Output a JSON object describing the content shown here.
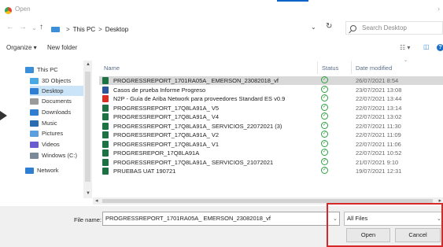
{
  "window": {
    "title": "Open"
  },
  "address": {
    "path": [
      "This PC",
      "Desktop"
    ],
    "separator": ">",
    "search_placeholder": "Search Desktop"
  },
  "toolbar": {
    "organize": "Organize ▾",
    "new_folder": "New folder"
  },
  "nav": {
    "items": [
      {
        "label": "This PC",
        "icon": "pc-icon",
        "color": "#3b8fd9"
      },
      {
        "label": "3D Objects",
        "icon": "3d-objects-icon",
        "color": "#49a8e6"
      },
      {
        "label": "Desktop",
        "icon": "desktop-icon",
        "color": "#2e7fd1",
        "selected": true
      },
      {
        "label": "Documents",
        "icon": "documents-icon",
        "color": "#9a9a9a"
      },
      {
        "label": "Downloads",
        "icon": "downloads-icon",
        "color": "#2e7fd1"
      },
      {
        "label": "Music",
        "icon": "music-icon",
        "color": "#2b6cb0"
      },
      {
        "label": "Pictures",
        "icon": "pictures-icon",
        "color": "#5aa0e0"
      },
      {
        "label": "Videos",
        "icon": "videos-icon",
        "color": "#6b5bd1"
      },
      {
        "label": "Windows (C:)",
        "icon": "drive-icon",
        "color": "#7a8a99"
      },
      {
        "label": "Network",
        "icon": "network-icon",
        "color": "#2e7fd1"
      }
    ]
  },
  "columns": {
    "name": "Name",
    "status": "Status",
    "date": "Date modified"
  },
  "files": [
    {
      "name": "PROGRESSREPORT_1701RA05A_ EMERSON_23082018_vf",
      "date": "26/07/2021 8:54",
      "type": "xls",
      "selected": true
    },
    {
      "name": "Casos de prueba Informe Progreso",
      "date": "23/07/2021 13:08",
      "type": "doc"
    },
    {
      "name": "N2P - Guía de Ariba Network para proveedores Standard ES v0.9",
      "date": "22/07/2021 13:44",
      "type": "pdf"
    },
    {
      "name": "PROGRESSREPORT_17Q8LA91A_ V5",
      "date": "22/07/2021 13:14",
      "type": "xls"
    },
    {
      "name": "PROGRESSREPORT_17Q8LA91A_ V4",
      "date": "22/07/2021 13:02",
      "type": "xls"
    },
    {
      "name": "PROGRESSREPORT_17Q8LA91A_ SERVICIOS_22072021 (3)",
      "date": "22/07/2021 11:30",
      "type": "xls"
    },
    {
      "name": "PROGRESSREPORT_17Q8LA91A_ V2",
      "date": "22/07/2021 11:09",
      "type": "xls"
    },
    {
      "name": "PROGRESSREPORT_17Q8LA91A_ V1",
      "date": "22/07/2021 11:06",
      "type": "xls"
    },
    {
      "name": "PROGRESREPOR_17Q8LA91A",
      "date": "22/07/2021 10:52",
      "type": "xls"
    },
    {
      "name": "PROGRESSREPORT_17Q8LA91A_ SERVICIOS_21072021",
      "date": "21/07/2021 9:10",
      "type": "xls"
    },
    {
      "name": "PRUEBAS UAT 190721",
      "date": "19/07/2021 12:31",
      "type": "xls"
    }
  ],
  "bottom": {
    "file_name_label": "File name:",
    "file_name_value": "PROGRESSREPORT_1701RA05A_ EMERSON_23082018_vf",
    "file_type": "All Files",
    "open_label": "Open",
    "cancel_label": "Cancel"
  },
  "colors": {
    "selection_nav": "#cce4f7",
    "selection_row": "#d9d9d9",
    "highlight": "#d62828",
    "status_ok": "#2ea043"
  }
}
